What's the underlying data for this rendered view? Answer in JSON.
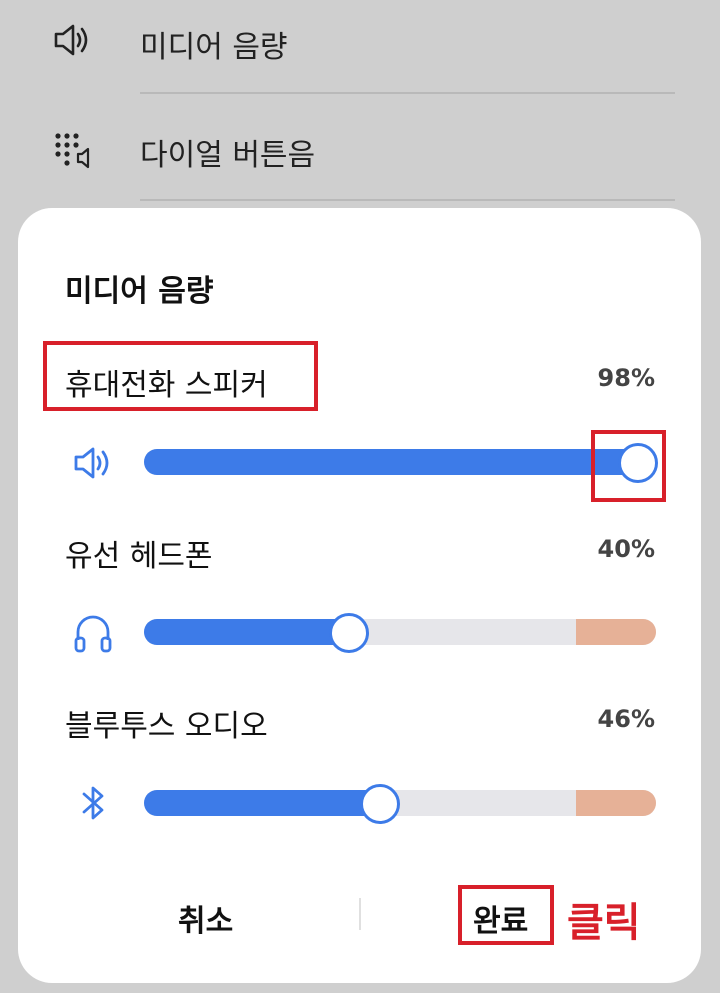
{
  "background": {
    "rows": [
      {
        "icon": "speaker-icon",
        "label": "미디어 음량"
      },
      {
        "icon": "dialpad-icon",
        "label": "다이얼 버튼음"
      }
    ]
  },
  "dialog": {
    "title": "미디어 음량",
    "devices": [
      {
        "name": "휴대전화 스피커",
        "percent_label": "98%",
        "level": 0.98,
        "icon": "speaker-icon",
        "warning_zone": false
      },
      {
        "name": "유선 헤드폰",
        "percent_label": "40%",
        "level": 0.4,
        "icon": "headphones-icon",
        "warning_zone": true
      },
      {
        "name": "블루투스 오디오",
        "percent_label": "46%",
        "level": 0.46,
        "icon": "bluetooth-icon",
        "warning_zone": true
      }
    ],
    "cancel_label": "취소",
    "done_label": "완료"
  },
  "annotation": {
    "click_label": "클릭",
    "color": "#d8202a"
  },
  "colors": {
    "accent": "#3d7be8",
    "warning": "#e6b197",
    "track": "#e6e6ea"
  }
}
